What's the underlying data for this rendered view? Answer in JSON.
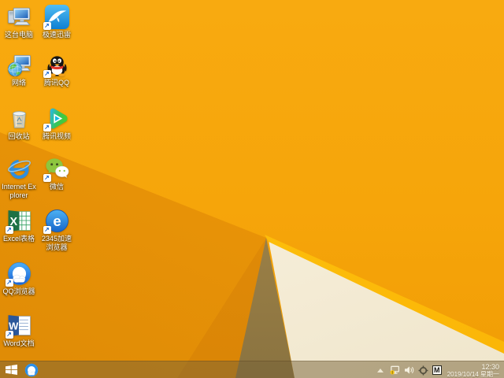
{
  "desktop": {
    "icons": [
      {
        "label": "这台电脑",
        "type": "this-pc",
        "shortcut": false
      },
      {
        "label": "极速迅雷",
        "type": "xunlei",
        "shortcut": true
      },
      {
        "label": "网络",
        "type": "network",
        "shortcut": false
      },
      {
        "label": "腾讯QQ",
        "type": "tencent-qq",
        "shortcut": true
      },
      {
        "label": "回收站",
        "type": "recycle-bin",
        "shortcut": false
      },
      {
        "label": "腾讯视频",
        "type": "tencent-video",
        "shortcut": true
      },
      {
        "label": "Internet Explorer",
        "type": "internet-explorer",
        "shortcut": false
      },
      {
        "label": "微信",
        "type": "wechat",
        "shortcut": true
      },
      {
        "label": "Excel表格",
        "type": "excel",
        "shortcut": true,
        "glyph": "X"
      },
      {
        "label": "2345加速浏览器",
        "type": "browser-2345",
        "shortcut": true,
        "glyph": "e"
      },
      {
        "label": "QQ浏览器",
        "type": "qq-browser",
        "shortcut": true
      },
      {
        "label": "Word文档",
        "type": "word",
        "shortcut": true,
        "glyph": "W"
      }
    ]
  },
  "taskbar": {
    "start_button": {
      "name": "windows-start"
    },
    "pinned": [
      {
        "name": "qq-browser"
      }
    ],
    "tray": {
      "icons": [
        "show-hidden-icons",
        "network-status-warning",
        "volume",
        "safety-center",
        "input-method-indicator"
      ],
      "ime_label": "M",
      "clock": {
        "time": "12:30",
        "date": "2019/10/14 星期一"
      }
    }
  },
  "colors": {
    "wallpaper_orange": "#f6a50a",
    "wallpaper_fold_dark": "#df8b06",
    "wallpaper_shadow_khaki": "#a28549",
    "wallpaper_cream": "#f6eed9",
    "wallpaper_stripe": "#ffc60e",
    "taskbar_tint": "rgba(118,98,55,0.5)"
  }
}
